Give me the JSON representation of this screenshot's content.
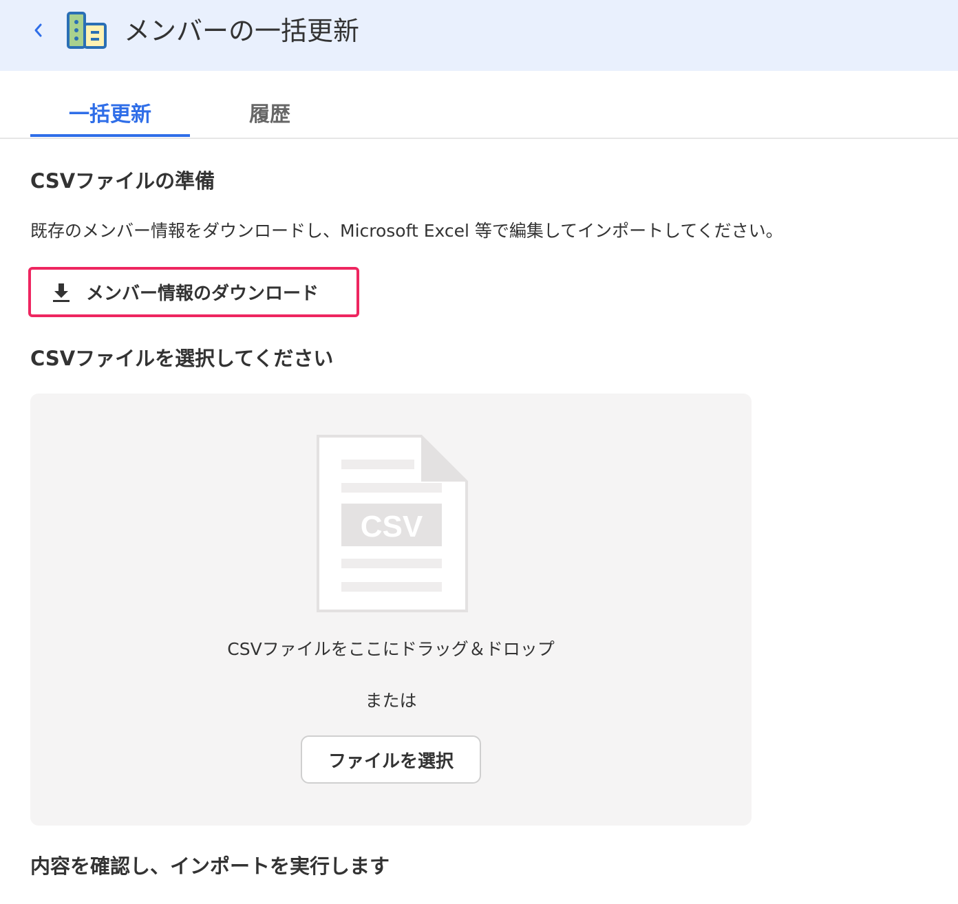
{
  "header": {
    "title": "メンバーの一括更新",
    "back_icon": "chevron-left-icon",
    "app_icon": "building-icon",
    "background_color": "#e9f0fd"
  },
  "tabs": [
    {
      "label": "一括更新",
      "active": true
    },
    {
      "label": "履歴",
      "active": false
    }
  ],
  "prepare": {
    "title": "CSVファイルの準備",
    "description": "既存のメンバー情報をダウンロードし、Microsoft Excel 等で編集してインポートしてください。",
    "download_button": {
      "label": "メンバー情報のダウンロード",
      "icon": "download-icon",
      "highlight_color": "#ee2660"
    }
  },
  "select": {
    "title": "CSVファイルを選択してください",
    "dropzone": {
      "illustration_label": "CSV",
      "drag_text": "CSVファイルをここにドラッグ＆ドロップ",
      "or_text": "または",
      "select_button": "ファイルを選択"
    }
  },
  "confirm": {
    "title": "内容を確認し、インポートを実行します"
  },
  "colors": {
    "accent": "#2f6ee8",
    "text": "#333333"
  }
}
